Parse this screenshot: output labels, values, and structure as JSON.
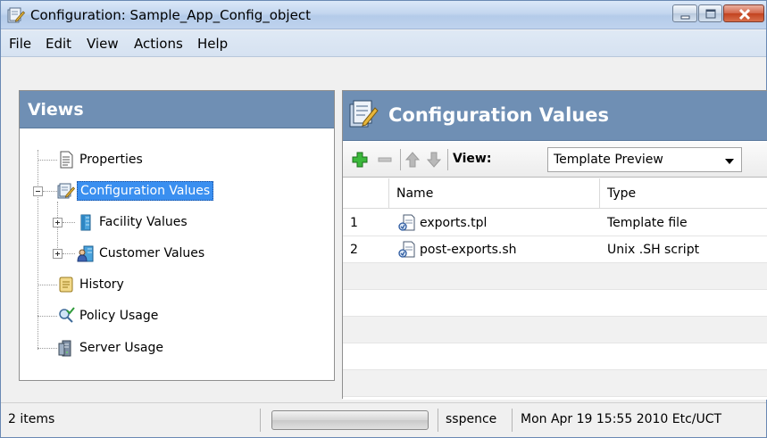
{
  "window": {
    "title": "Configuration: Sample_App_Config_object"
  },
  "menu": [
    "File",
    "Edit",
    "View",
    "Actions",
    "Help"
  ],
  "views_panel": {
    "title": "Views",
    "items": [
      {
        "label": "Properties",
        "icon": "document-icon"
      },
      {
        "label": "Configuration Values",
        "icon": "config-edit-icon",
        "selected": true
      },
      {
        "label": "Facility Values",
        "icon": "facility-icon"
      },
      {
        "label": "Customer Values",
        "icon": "customer-icon"
      },
      {
        "label": "History",
        "icon": "history-scroll-icon"
      },
      {
        "label": "Policy Usage",
        "icon": "policy-icon"
      },
      {
        "label": "Server Usage",
        "icon": "server-icon"
      }
    ]
  },
  "config_panel": {
    "title": "Configuration Values",
    "toolbar": {
      "view_label": "View:",
      "view_value": "Template Preview"
    },
    "table": {
      "columns": [
        "",
        "Name",
        "Type"
      ],
      "rows": [
        {
          "num": "1",
          "name": "exports.tpl",
          "type": "Template file"
        },
        {
          "num": "2",
          "name": "post-exports.sh",
          "type": "Unix .SH script"
        }
      ]
    }
  },
  "status": {
    "count": "2 items",
    "user": "sspence",
    "timestamp": "Mon Apr 19 15:55 2010 Etc/UCT"
  },
  "colors": {
    "panel_header": "#6f8fb4",
    "selection": "#3a8ff0",
    "close_button": "#c2421f"
  }
}
